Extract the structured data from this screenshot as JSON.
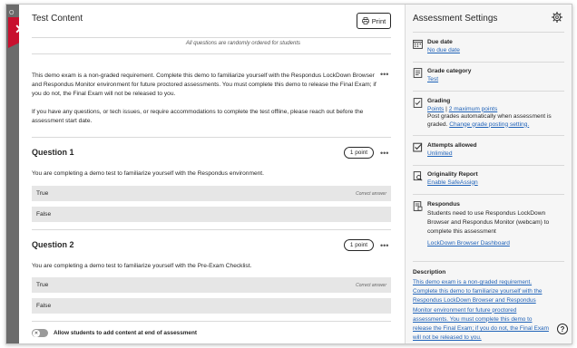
{
  "rail": {
    "mini_label": "O"
  },
  "main": {
    "title": "Test Content",
    "print_label": "Print",
    "random_note": "All questions are randomly ordered for students",
    "description_p1": "This demo exam is a non-graded requirement. Complete this demo to familiarize yourself with the Respondus LockDown Browser and Respondus Monitor environment for future proctored assessments. You must complete this demo to release the Final Exam; if you do not, the Final Exam will not be released to you.",
    "description_p2": "If you have any questions, or tech issues, or require accommodations to complete the test offline, please reach out before the assessment start date.",
    "questions": [
      {
        "title": "Question 1",
        "points": "1 point",
        "text": "You are completing a demo test to familiarize yourself with the Respondus environment.",
        "answers": [
          {
            "label": "True",
            "correct": "Correct answer"
          },
          {
            "label": "False",
            "correct": ""
          }
        ]
      },
      {
        "title": "Question 2",
        "points": "1 point",
        "text": "You are completing a demo test to familiarize yourself with the Pre-Exam Checklist.",
        "answers": [
          {
            "label": "True",
            "correct": "Correct answer"
          },
          {
            "label": "False",
            "correct": ""
          }
        ]
      }
    ],
    "toggle_label": "Allow students to add content at end of assessment"
  },
  "settings": {
    "title": "Assessment Settings",
    "due_date": {
      "head": "Due date",
      "value": "No due date"
    },
    "grade_category": {
      "head": "Grade category",
      "value": "Test"
    },
    "grading": {
      "head": "Grading",
      "points": "Points",
      "sep": "|",
      "max": "2 maximum points",
      "post_text": "Post grades automatically when assessment is graded.",
      "change_link": "Change grade posting setting."
    },
    "attempts": {
      "head": "Attempts allowed",
      "value": "Unlimited"
    },
    "originality": {
      "head": "Originality Report",
      "value": "Enable SafeAssign"
    },
    "respondus": {
      "head": "Respondus",
      "text": "Students need to use Respondus LockDown Browser and Respondus Monitor (webcam) to complete this assessment",
      "link": "LockDown Browser Dashboard"
    },
    "description_title": "Description",
    "description": "This demo exam is a non-graded requirement. Complete this demo to familiarize yourself with the Respondus LockDown Browser and Respondus Monitor environment for future proctored assessments. You must complete this demo to release the Final Exam; if you do not, the Final Exam will not be released to you."
  },
  "help_label": "?",
  "colors": {
    "close_tab": "#c8102e",
    "link": "#1f62b8",
    "rail": "#6b6b6b",
    "answer_bg": "#e6e6e6"
  },
  "icons": [
    "close-icon",
    "print-icon",
    "more-icon",
    "gear-icon",
    "calendar-icon",
    "grade-category-icon",
    "grading-icon",
    "attempts-icon",
    "originality-icon",
    "respondus-icon",
    "help-icon"
  ]
}
